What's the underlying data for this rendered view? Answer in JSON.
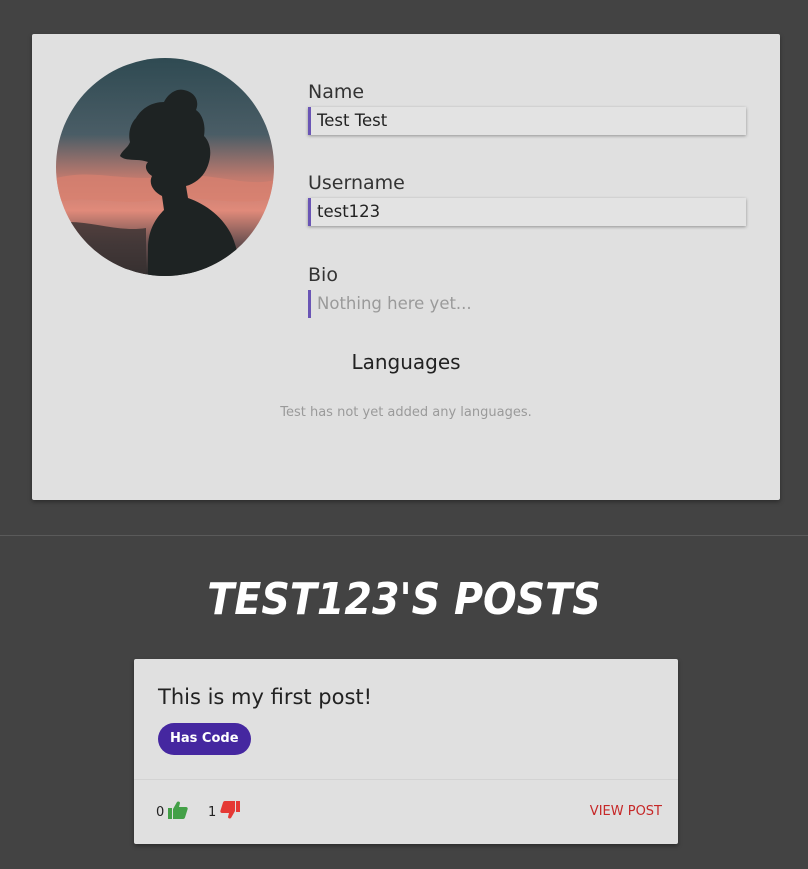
{
  "profile": {
    "avatar_alt": "profile-avatar",
    "name_label": "Name",
    "name_value": "Test Test",
    "username_label": "Username",
    "username_value": "test123",
    "bio_label": "Bio",
    "bio_placeholder": "Nothing here yet...",
    "languages_title": "Languages",
    "languages_empty": "Test has not yet added any languages."
  },
  "posts": {
    "title": "test123's posts",
    "items": [
      {
        "title": "This is my first post!",
        "tag": "Has Code",
        "upvotes": "0",
        "downvotes": "1",
        "view_label": "VIEW POST"
      }
    ]
  },
  "colors": {
    "background": "#434343",
    "card": "#e0e0e0",
    "accent": "#6a55b5",
    "tag": "#4527a0",
    "upvote": "#43a047",
    "downvote": "#e53935",
    "link": "#c62828"
  },
  "icons": {
    "upvote": "thumbs-up-icon",
    "downvote": "thumbs-down-icon"
  }
}
